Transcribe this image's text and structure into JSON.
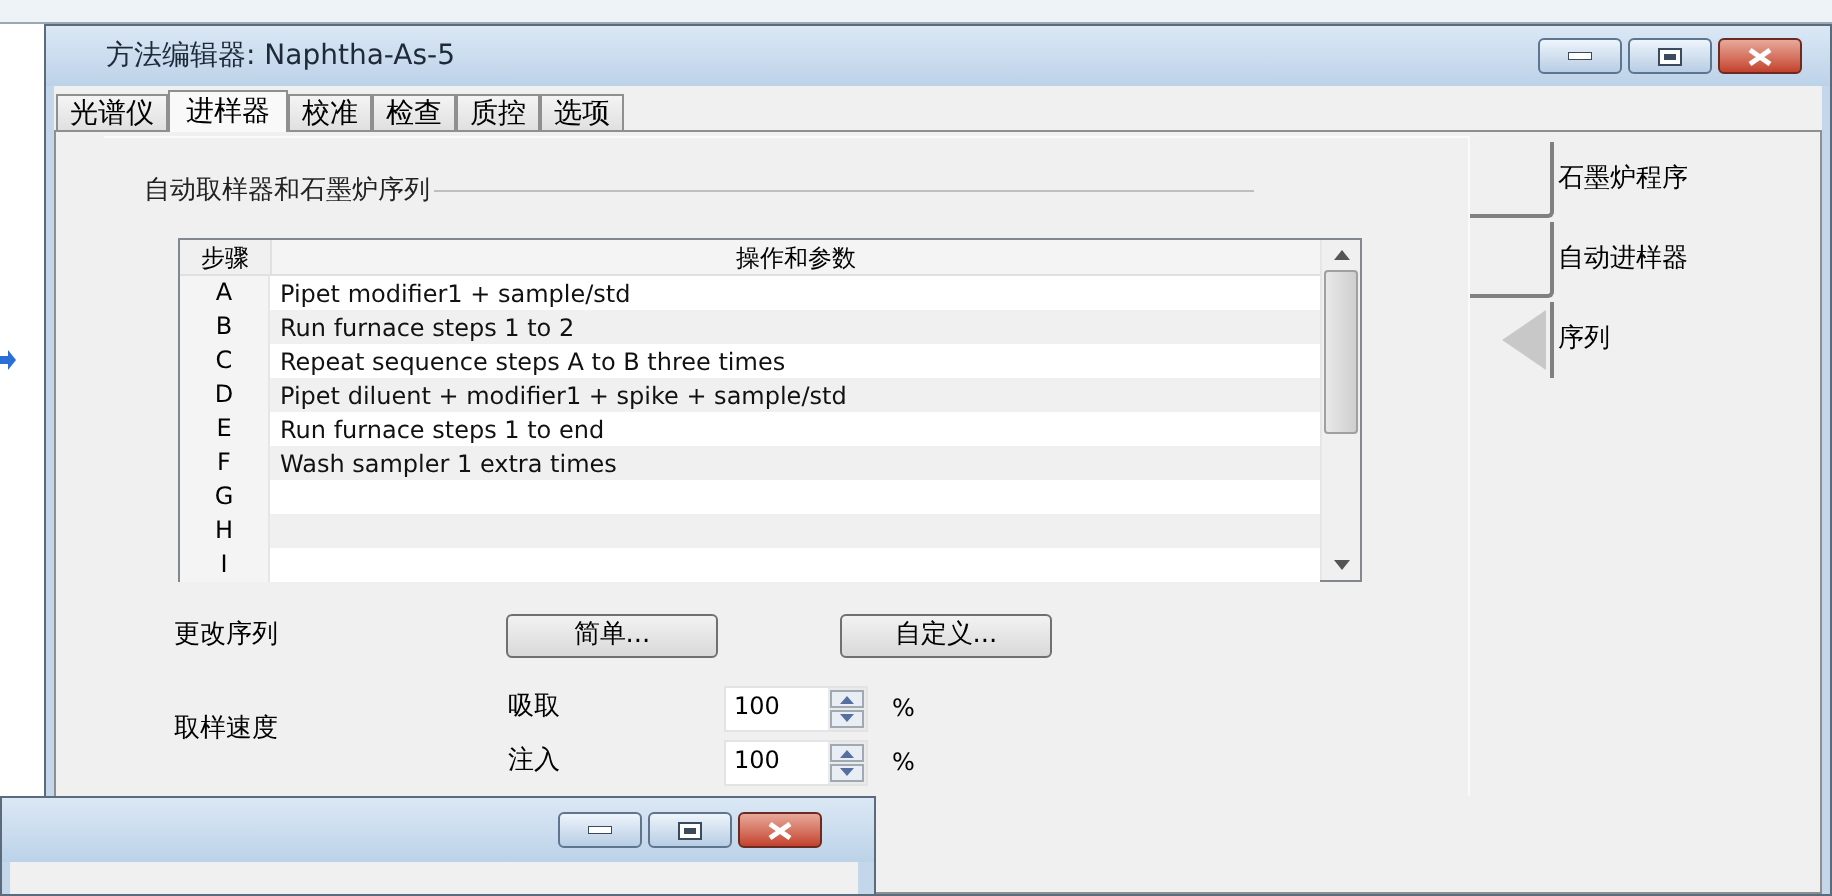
{
  "window": {
    "title": "方法编辑器: Naphtha-As-5"
  },
  "tabs": [
    {
      "label": "光谱仪",
      "selected": false
    },
    {
      "label": "进样器",
      "selected": true
    },
    {
      "label": "校准",
      "selected": false
    },
    {
      "label": "检查",
      "selected": false
    },
    {
      "label": "质控",
      "selected": false
    },
    {
      "label": "选项",
      "selected": false
    }
  ],
  "group_title": "自动取样器和石墨炉序列",
  "table": {
    "columns": [
      "步骤",
      "操作和参数"
    ],
    "rows": [
      {
        "step": "A",
        "action": "Pipet modifier1 + sample/std"
      },
      {
        "step": "B",
        "action": "Run furnace steps 1 to 2"
      },
      {
        "step": "C",
        "action": "Repeat sequence steps A to B three times"
      },
      {
        "step": "D",
        "action": "Pipet diluent + modifier1 + spike + sample/std"
      },
      {
        "step": "E",
        "action": "Run furnace steps 1 to end"
      },
      {
        "step": "F",
        "action": "Wash sampler 1 extra times"
      },
      {
        "step": "G"
      },
      {
        "step": "H"
      },
      {
        "step": "I"
      }
    ]
  },
  "side_tabs": [
    {
      "label": "石墨炉程序",
      "selected": false
    },
    {
      "label": "自动进样器",
      "selected": false
    },
    {
      "label": "序列",
      "selected": true
    }
  ],
  "change_sequence": {
    "label": "更改序列",
    "buttons": [
      "简单...",
      "自定义..."
    ]
  },
  "sampling_speed": {
    "label": "取样速度",
    "fields": [
      {
        "label": "吸取",
        "value": "100",
        "unit": "%"
      },
      {
        "label": "注入",
        "value": "100",
        "unit": "%"
      }
    ]
  }
}
